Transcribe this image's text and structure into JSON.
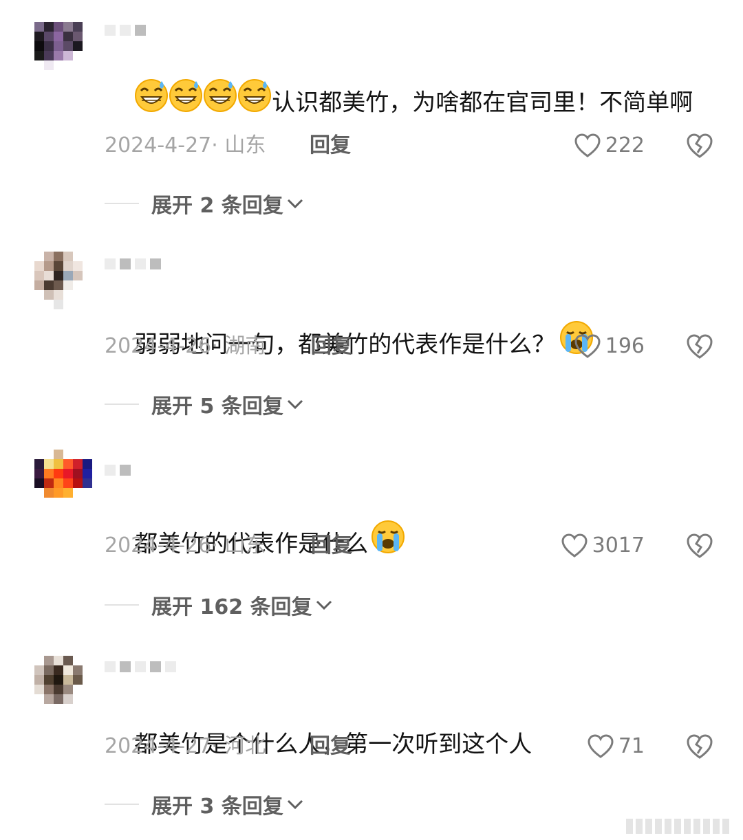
{
  "comments": [
    {
      "text": "认识都美竹，为啥都在官司里！不简单啊",
      "emoji_prefix": [
        "grinning-sweat-emoji",
        "grinning-sweat-emoji",
        "grinning-sweat-emoji",
        "grinning-sweat-emoji"
      ],
      "date": "2024-4-27· 山东",
      "reply_label": "回复",
      "likes": "222",
      "expand_label": "展开 2 条回复"
    },
    {
      "text": "弱弱地问一句，都美竹的代表作是什么？",
      "emoji_suffix": "crying-emoji",
      "date": "2024-4-26· 湖南",
      "reply_label": "回复",
      "likes": "196",
      "expand_label": "展开 5 条回复"
    },
    {
      "text": "都美竹的代表作是什么",
      "emoji_suffix": "crying-emoji",
      "date": "2024-4-26· 山东",
      "reply_label": "回复",
      "likes": "3017",
      "expand_label": "展开 162 条回复"
    },
    {
      "text": "都美竹是个什么人，第一次听到这个人",
      "date": "2024-4-27· 河北",
      "reply_label": "回复",
      "likes": "71",
      "expand_label": "展开 3 条回复"
    }
  ],
  "colors": {
    "text": "#141414",
    "meta": "#a5a5a5",
    "action": "#5f5f5f",
    "background": "#ffffff"
  }
}
